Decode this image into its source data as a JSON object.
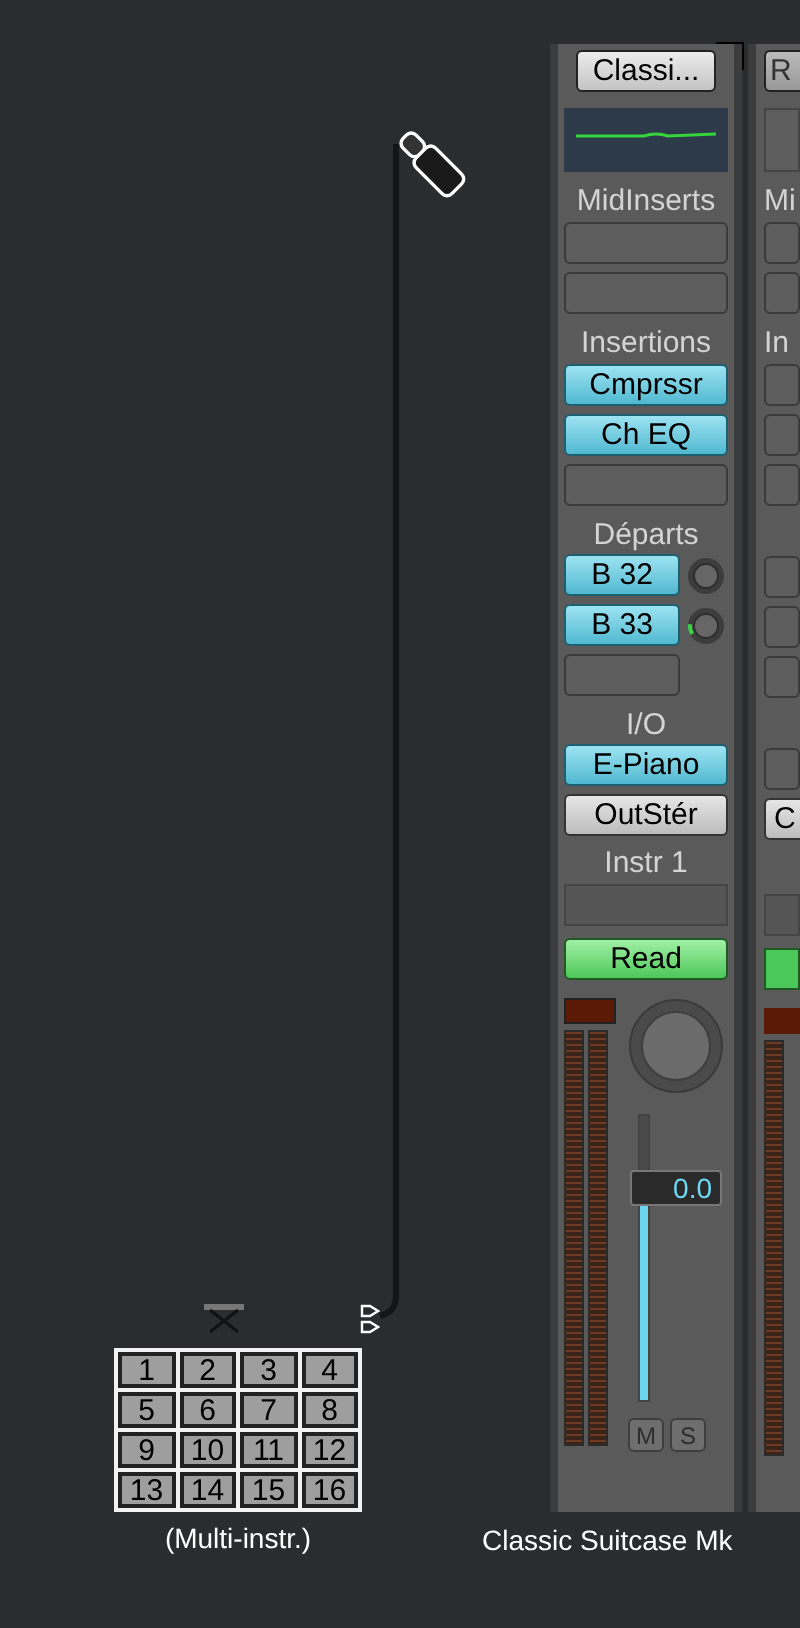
{
  "multi_instrument": {
    "channels": [
      "1",
      "2",
      "3",
      "4",
      "5",
      "6",
      "7",
      "8",
      "9",
      "10",
      "11",
      "12",
      "13",
      "14",
      "15",
      "16"
    ],
    "label": "(Multi-instr.)"
  },
  "channel_strip": {
    "setting_button": "Classi...",
    "midi_inserts_label": "MidInserts",
    "insertions_label": "Insertions",
    "insertions": [
      {
        "label": "Cmprssr"
      },
      {
        "label": "Ch EQ"
      }
    ],
    "sends_label": "Départs",
    "sends": [
      {
        "label": "B 32"
      },
      {
        "label": "B 33",
        "level": 0.12
      }
    ],
    "io_label": "I/O",
    "input": "E-Piano",
    "output": "OutStér",
    "track_label": "Instr 1",
    "automation": "Read",
    "fader": {
      "level": 0.74,
      "reading": "0.0"
    },
    "mute": "M",
    "solo": "S",
    "name": "Classic Suitcase Mk"
  },
  "next_strip": {
    "setting_button": "R",
    "midi_inserts_label": "Mi",
    "insertions_label": "In",
    "output": "C"
  }
}
